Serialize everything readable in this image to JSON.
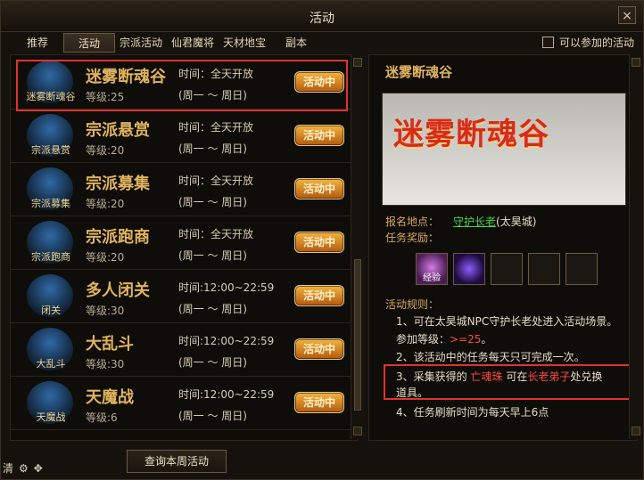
{
  "window": {
    "title": "活动",
    "close_label": "×"
  },
  "tabs": [
    {
      "label": "推荐"
    },
    {
      "label": "活动"
    },
    {
      "label": "宗派活动"
    },
    {
      "label": "仙君魔将"
    },
    {
      "label": "天材地宝"
    },
    {
      "label": "副本"
    }
  ],
  "active_tab_index": 1,
  "only_available": {
    "label": "可以参加的活动",
    "checked": false
  },
  "activities": [
    {
      "icon_label": "迷雾断魂谷",
      "name": "迷雾断魂谷",
      "level": "等级:25",
      "time": "时间：全天开放",
      "days": "(周一 ～ 周日)",
      "status": "活动中"
    },
    {
      "icon_label": "宗派悬赏",
      "name": "宗派悬赏",
      "level": "等级:20",
      "time": "时间：全天开放",
      "days": "(周一 ～ 周日)",
      "status": "活动中"
    },
    {
      "icon_label": "宗派募集",
      "name": "宗派募集",
      "level": "等级:20",
      "time": "时间：全天开放",
      "days": "(周一 ～ 周日)",
      "status": "活动中"
    },
    {
      "icon_label": "宗派跑商",
      "name": "宗派跑商",
      "level": "等级:20",
      "time": "时间：全天开放",
      "days": "(周一 ～ 周日)",
      "status": "活动中"
    },
    {
      "icon_label": "闭关",
      "name": "多人闭关",
      "level": "等级:30",
      "time": "时间:12:00~22:59",
      "days": "(周一 ～ 周日)",
      "status": "活动中"
    },
    {
      "icon_label": "大乱斗",
      "name": "大乱斗",
      "level": "等级:30",
      "time": "时间:12:00~22:59",
      "days": "(周一 ～ 周日)",
      "status": "活动中"
    },
    {
      "icon_label": "天魔战",
      "name": "天魔战",
      "level": "等级:6",
      "time": "时间:12:00~22:59",
      "days": "(周一 ～ 周日)",
      "status": "活动中"
    }
  ],
  "bottom_button": {
    "label": "查询本周活动"
  },
  "footer": {
    "text": "清"
  },
  "detail": {
    "title": "迷雾断魂谷",
    "banner_text": "迷雾断魂谷",
    "signup_label": "报名地点：",
    "signup_npc": "守护长老",
    "signup_place": "(太昊城)",
    "reward_label": "任务奖励：",
    "reward_slot_label": "经验",
    "rules_title": "活动规则：",
    "rule1_a": "1、可在太昊城NPC守护长老处进入活动场景。",
    "rule1_b_prefix": "参加等级：",
    "rule1_b_value": ">=25",
    "rule1_b_suffix": "。",
    "rule2": "2、该活动中的任务每天只可完成一次。",
    "rule3_prefix": "3、采集获得的",
    "rule3_item": "亡魂珠",
    "rule3_mid": "可在",
    "rule3_npc": "长老弟子",
    "rule3_suffix": "处兑换",
    "rule3_line2": "道具。",
    "rule4": "4、任务刷新时间为每天早上6点"
  }
}
